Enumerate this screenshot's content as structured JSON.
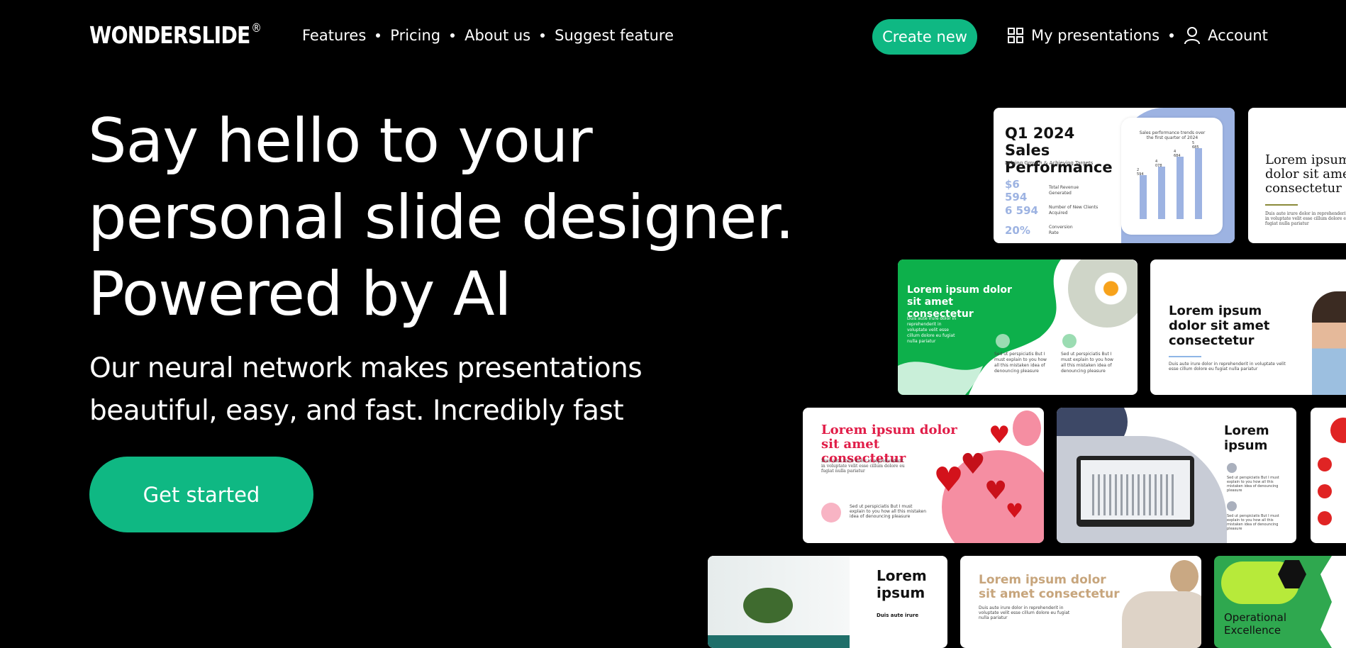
{
  "header": {
    "logo": "WONDERSLIDE",
    "logo_mark": "®",
    "nav": [
      "Features",
      "Pricing",
      "About us",
      "Suggest feature"
    ],
    "create_button": "Create new",
    "my_presentations": "My presentations",
    "account": "Account"
  },
  "hero": {
    "title_line1": "Say hello to your",
    "title_line2": "personal slide designer.",
    "title_line3": "Powered by AI",
    "subtitle_line1": "Our neural network makes presentations",
    "subtitle_line2": "beautiful, easy, and fast. Incredibly fast",
    "cta": "Get started"
  },
  "slides": {
    "sales": {
      "title": "Q1 2024 Sales Performance",
      "subtitle": "Driving Growth & Achieving Targets",
      "chart_caption": "Sales performance trends over the first quarter of 2024",
      "stats": [
        {
          "value": "$6 594",
          "label": "Total Revenue Generated"
        },
        {
          "value": "6 594",
          "label": "Number of New Clients Acquired"
        },
        {
          "value": "20%",
          "label": "Conversion Rate"
        }
      ],
      "bars": [
        "2 594",
        "4 078",
        "4 684",
        "5 685"
      ]
    },
    "lorem_title": "Lorem ipsum dolor sit amet consectetur",
    "lorem_short": "Lorem ipsum",
    "lorem_body": "Duis aute irure dolor in reprehenderit in voluptate velit esse cillum dolore eu fugiat nulla pariatur",
    "lorem_item": "Sed ut perspiciatis But I must explain to you how all this mistaken idea of denouncing pleasure",
    "lorem_item_short": "Duis aute irure",
    "excellence": "Operational Excellence"
  },
  "colors": {
    "accent": "#0fb883",
    "background": "#000000"
  }
}
